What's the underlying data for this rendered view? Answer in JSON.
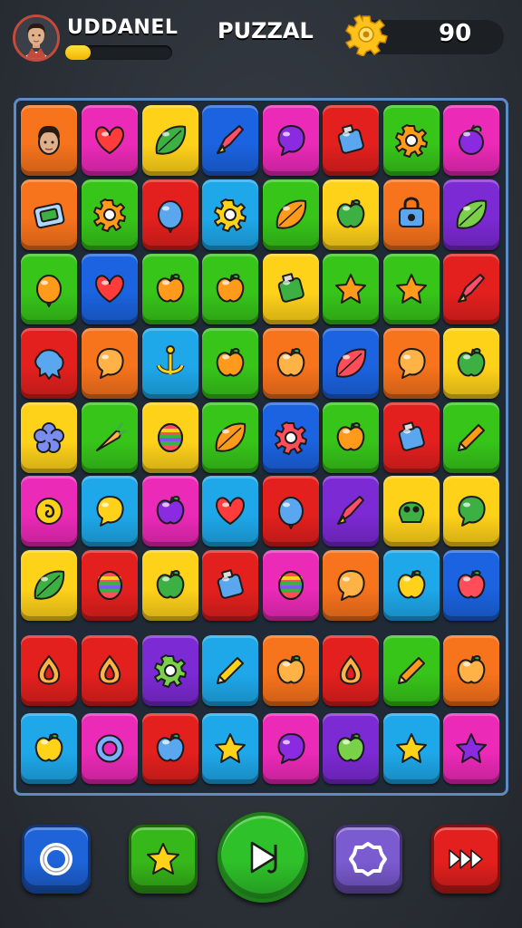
{
  "header": {
    "username": "UDDANEL",
    "xp_progress": 0.24,
    "game_title": "PUZZAL",
    "score": "90"
  },
  "colors": {
    "orange": "#f7731c",
    "magenta": "#ec2ab8",
    "yellow": "#ffd21a",
    "blue": "#1b63e0",
    "red": "#e3201e",
    "green": "#37c51a",
    "cyan": "#1ea8ea",
    "purple": "#7c2ad4"
  },
  "board": {
    "rows": [
      [
        {
          "c": "orange",
          "icon": "avatar-face"
        },
        {
          "c": "magenta",
          "icon": "heart"
        },
        {
          "c": "yellow",
          "icon": "leaf"
        },
        {
          "c": "blue",
          "icon": "rocket"
        },
        {
          "c": "magenta",
          "icon": "bubble"
        },
        {
          "c": "red",
          "icon": "potion"
        },
        {
          "c": "green",
          "icon": "gear"
        },
        {
          "c": "magenta",
          "icon": "fruit"
        }
      ],
      [
        {
          "c": "orange",
          "icon": "chest"
        },
        {
          "c": "green",
          "icon": "gear"
        },
        {
          "c": "red",
          "icon": "balloon"
        },
        {
          "c": "cyan",
          "icon": "gear"
        },
        {
          "c": "green",
          "icon": "leaf"
        },
        {
          "c": "yellow",
          "icon": "apple"
        },
        {
          "c": "orange",
          "icon": "lock"
        },
        {
          "c": "purple",
          "icon": "leaf"
        }
      ],
      [
        {
          "c": "green",
          "icon": "balloon"
        },
        {
          "c": "blue",
          "icon": "heart"
        },
        {
          "c": "green",
          "icon": "apple"
        },
        {
          "c": "green",
          "icon": "apple"
        },
        {
          "c": "yellow",
          "icon": "potion"
        },
        {
          "c": "green",
          "icon": "star"
        },
        {
          "c": "green",
          "icon": "star"
        },
        {
          "c": "red",
          "icon": "rocket"
        }
      ],
      [
        {
          "c": "red",
          "icon": "splat"
        },
        {
          "c": "orange",
          "icon": "bubble"
        },
        {
          "c": "cyan",
          "icon": "anchor"
        },
        {
          "c": "green",
          "icon": "apple"
        },
        {
          "c": "orange",
          "icon": "apple"
        },
        {
          "c": "blue",
          "icon": "leaf"
        },
        {
          "c": "orange",
          "icon": "bubble"
        },
        {
          "c": "yellow",
          "icon": "apple"
        }
      ],
      [
        {
          "c": "yellow",
          "icon": "flower"
        },
        {
          "c": "green",
          "icon": "carrot"
        },
        {
          "c": "yellow",
          "icon": "egg"
        },
        {
          "c": "green",
          "icon": "leaf"
        },
        {
          "c": "blue",
          "icon": "gear"
        },
        {
          "c": "green",
          "icon": "apple"
        },
        {
          "c": "red",
          "icon": "potion"
        },
        {
          "c": "green",
          "icon": "pencil"
        }
      ],
      [
        {
          "c": "magenta",
          "icon": "swirl"
        },
        {
          "c": "cyan",
          "icon": "bubble"
        },
        {
          "c": "magenta",
          "icon": "apple"
        },
        {
          "c": "cyan",
          "icon": "heart"
        },
        {
          "c": "red",
          "icon": "balloon"
        },
        {
          "c": "purple",
          "icon": "rocket"
        },
        {
          "c": "yellow",
          "icon": "skull"
        },
        {
          "c": "yellow",
          "icon": "bubble"
        }
      ],
      [
        {
          "c": "yellow",
          "icon": "leaf"
        },
        {
          "c": "red",
          "icon": "egg"
        },
        {
          "c": "yellow",
          "icon": "apple"
        },
        {
          "c": "red",
          "icon": "potion"
        },
        {
          "c": "magenta",
          "icon": "egg"
        },
        {
          "c": "orange",
          "icon": "bubble"
        },
        {
          "c": "cyan",
          "icon": "apple"
        },
        {
          "c": "blue",
          "icon": "apple"
        }
      ],
      [
        {
          "c": "red",
          "icon": "drop"
        },
        {
          "c": "red",
          "icon": "drop"
        },
        {
          "c": "purple",
          "icon": "gear"
        },
        {
          "c": "cyan",
          "icon": "pencil"
        },
        {
          "c": "orange",
          "icon": "apple"
        },
        {
          "c": "red",
          "icon": "drop"
        },
        {
          "c": "green",
          "icon": "pencil"
        },
        {
          "c": "orange",
          "icon": "apple"
        }
      ],
      [
        {
          "c": "cyan",
          "icon": "apple"
        },
        {
          "c": "magenta",
          "icon": "ring"
        },
        {
          "c": "red",
          "icon": "apple"
        },
        {
          "c": "cyan",
          "icon": "star"
        },
        {
          "c": "magenta",
          "icon": "bubble"
        },
        {
          "c": "purple",
          "icon": "apple"
        },
        {
          "c": "cyan",
          "icon": "star"
        },
        {
          "c": "magenta",
          "icon": "star"
        }
      ]
    ]
  },
  "bottom_buttons": [
    {
      "name": "ring-button",
      "icon": "ring",
      "color": "#1e63d8"
    },
    {
      "name": "star-button",
      "icon": "star",
      "color": "#36b71a"
    },
    {
      "name": "play-button",
      "icon": "play",
      "color": "#2fc12a"
    },
    {
      "name": "shield-button",
      "icon": "badge",
      "color": "#7b5bd0"
    },
    {
      "name": "fast-forward-button",
      "icon": "fastforward",
      "color": "#e3201e"
    }
  ]
}
